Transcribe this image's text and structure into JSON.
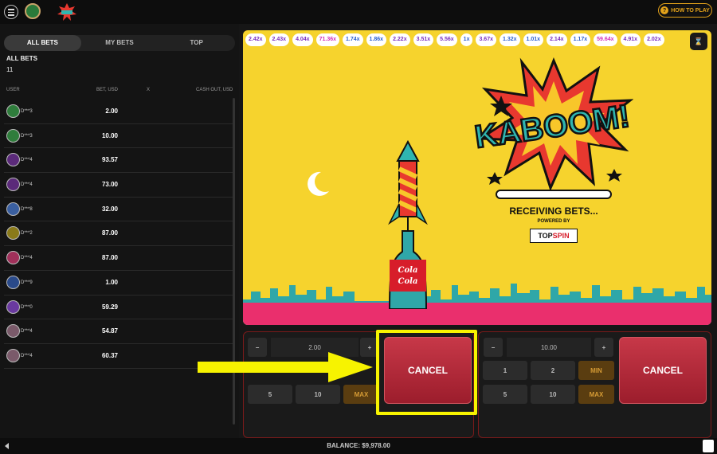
{
  "header": {
    "how_to_play": "HOW TO PLAY"
  },
  "tabs": [
    "ALL BETS",
    "MY BETS",
    "TOP"
  ],
  "bets_section": {
    "title": "ALL BETS",
    "count": "11"
  },
  "columns": {
    "user": "USER",
    "bet": "BET, USD",
    "x": "X",
    "cashout": "CASH OUT, USD"
  },
  "bets": [
    {
      "user": "D***3",
      "bet": "2.00",
      "avatar": "#2f7d3c"
    },
    {
      "user": "D***3",
      "bet": "10.00",
      "avatar": "#2f7d3c"
    },
    {
      "user": "D***4",
      "bet": "93.57",
      "avatar": "#5b2a7a"
    },
    {
      "user": "D***4",
      "bet": "73.00",
      "avatar": "#5b2a7a"
    },
    {
      "user": "D***8",
      "bet": "32.00",
      "avatar": "#3a5fa0"
    },
    {
      "user": "D***2",
      "bet": "87.00",
      "avatar": "#8a7a1a"
    },
    {
      "user": "D***4",
      "bet": "87.00",
      "avatar": "#a0305a"
    },
    {
      "user": "D***9",
      "bet": "1.00",
      "avatar": "#2a4a8a"
    },
    {
      "user": "D***0",
      "bet": "59.29",
      "avatar": "#6a3aa0"
    },
    {
      "user": "D***4",
      "bet": "54.87",
      "avatar": "#7a5a6a"
    },
    {
      "user": "D***4",
      "bet": "60.37",
      "avatar": "#7a5a6a"
    }
  ],
  "multipliers": [
    {
      "v": "2.42x",
      "c": "#7b2fc0"
    },
    {
      "v": "2.43x",
      "c": "#7b2fc0"
    },
    {
      "v": "4.04x",
      "c": "#7b2fc0"
    },
    {
      "v": "71.36x",
      "c": "#d42fb8"
    },
    {
      "v": "1.74x",
      "c": "#2a5fd0"
    },
    {
      "v": "1.86x",
      "c": "#2a5fd0"
    },
    {
      "v": "2.22x",
      "c": "#7b2fc0"
    },
    {
      "v": "3.51x",
      "c": "#7b2fc0"
    },
    {
      "v": "5.56x",
      "c": "#7b2fc0"
    },
    {
      "v": "1x",
      "c": "#2a5fd0"
    },
    {
      "v": "3.67x",
      "c": "#7b2fc0"
    },
    {
      "v": "1.32x",
      "c": "#2a5fd0"
    },
    {
      "v": "1.01x",
      "c": "#2a5fd0"
    },
    {
      "v": "2.14x",
      "c": "#7b2fc0"
    },
    {
      "v": "1.17x",
      "c": "#2a5fd0"
    },
    {
      "v": "59.64x",
      "c": "#d42fb8"
    },
    {
      "v": "4.91x",
      "c": "#7b2fc0"
    },
    {
      "v": "2.02x",
      "c": "#7b2fc0"
    }
  ],
  "game": {
    "title": "KABOOM!",
    "status": "RECEIVING BETS...",
    "powered_by": "POWERED BY",
    "brand_a": "TOP",
    "brand_b": "SPIN",
    "bottle_label_1": "Cola",
    "bottle_label_2": "Cola"
  },
  "panel1": {
    "amount": "2.00",
    "minus": "−",
    "plus": "+",
    "quick": [
      "5",
      "10",
      "MAX"
    ],
    "cancel": "CANCEL"
  },
  "panel2": {
    "amount": "10.00",
    "minus": "−",
    "plus": "+",
    "quick_top": [
      "1",
      "2",
      "MIN"
    ],
    "quick": [
      "5",
      "10",
      "MAX"
    ],
    "cancel": "CANCEL"
  },
  "footer": {
    "balance": "BALANCE: $9,978.00"
  },
  "colors": {
    "accent": "#e3a21a",
    "game_bg": "#f6d32d",
    "cancel": "#b12a3a",
    "highlight": "#f7f300"
  }
}
